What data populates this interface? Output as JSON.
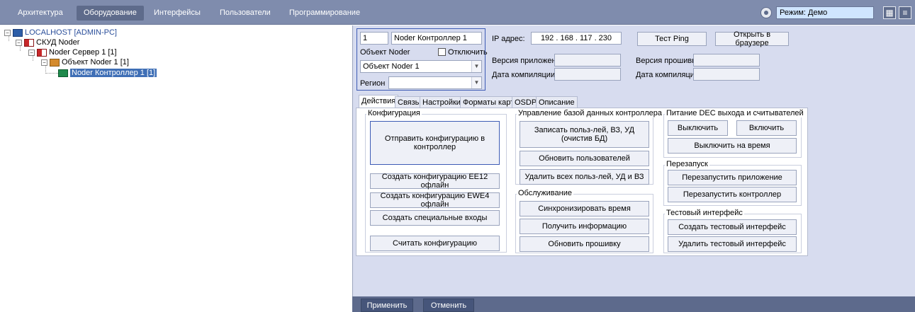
{
  "topbar": {
    "tabs": [
      {
        "label": "Архитектура"
      },
      {
        "label": "Оборудование"
      },
      {
        "label": "Интерфейсы"
      },
      {
        "label": "Пользователи"
      },
      {
        "label": "Программирование"
      }
    ],
    "active_tab": "Оборудование",
    "mode_text": "Режим: Демо",
    "colors": {
      "bar": "#7f8cad",
      "active_tab": "#5e6b8b",
      "mode_box": "#cfe5ff"
    }
  },
  "tree": {
    "items": [
      {
        "label": "LOCALHOST [ADMIN-PC]",
        "icon": "computer-icon"
      },
      {
        "label": "СКУД Noder",
        "icon": "flag-icon"
      },
      {
        "label": "Noder Сервер 1 [1]",
        "icon": "flag-icon"
      },
      {
        "label": "Объект Noder 1 [1]",
        "icon": "object-icon"
      },
      {
        "label": "Noder Контроллер 1 [1]",
        "icon": "controller-icon"
      }
    ]
  },
  "object_box": {
    "id_value": "1",
    "name_value": "Noder Контроллер 1",
    "object_label": "Объект Noder",
    "disable_label": "Отключить",
    "object_value": "Объект Noder 1",
    "region_label": "Регион",
    "region_value": ""
  },
  "connection": {
    "ip_label": "IP адрес:",
    "ip_value": "192 . 168 . 117 . 230",
    "test_ping": "Тест Ping",
    "open_browser": "Открыть в браузере",
    "app_version_label": "Версия приложения:",
    "app_version_value": "",
    "compile_date_label": "Дата компиляции:",
    "compile_date_value": "",
    "fw_version_label": "Версия прошивки:",
    "fw_version_value": "",
    "fw_compile_date_label": "Дата компиляции:",
    "fw_compile_date_value": ""
  },
  "tabs": [
    {
      "label": "Действия"
    },
    {
      "label": "Связь"
    },
    {
      "label": "Настройки"
    },
    {
      "label": "Форматы карт"
    },
    {
      "label": "OSDP"
    },
    {
      "label": "Описание"
    }
  ],
  "config_group": {
    "title": "Конфигурация",
    "send": "Отправить конфигурацию в контроллер",
    "ee12": "Создать конфигурацию EE12 офлайн",
    "ewe4": "Создать конфигурацию EWE4 офлайн",
    "special_inputs": "Создать специальные входы",
    "read": "Считать конфигурацию"
  },
  "db_group": {
    "title": "Управление базой данных контроллера",
    "write_users": "Записать польз-лей, ВЗ, УД (очистив БД)",
    "update_users": "Обновить пользователей",
    "delete_all": "Удалить всех польз-лей, УД и ВЗ"
  },
  "service_group": {
    "title": "Обслуживание",
    "sync_time": "Синхронизировать время",
    "get_info": "Получить информацию",
    "update_fw": "Обновить прошивку"
  },
  "power_group": {
    "title": "Питание DEC выхода и считывателей",
    "off": "Выключить",
    "on": "Включить",
    "off_timed": "Выключить на время"
  },
  "restart_group": {
    "title": "Перезапуск",
    "restart_app": "Перезапустить приложение",
    "restart_ctrl": "Перезапустить контроллер"
  },
  "test_group": {
    "title": "Тестовый интерфейс",
    "create": "Создать тестовый интерфейс",
    "delete": "Удалить тестовый интерфейс"
  },
  "bottombar": {
    "apply": "Применить",
    "cancel": "Отменить"
  }
}
